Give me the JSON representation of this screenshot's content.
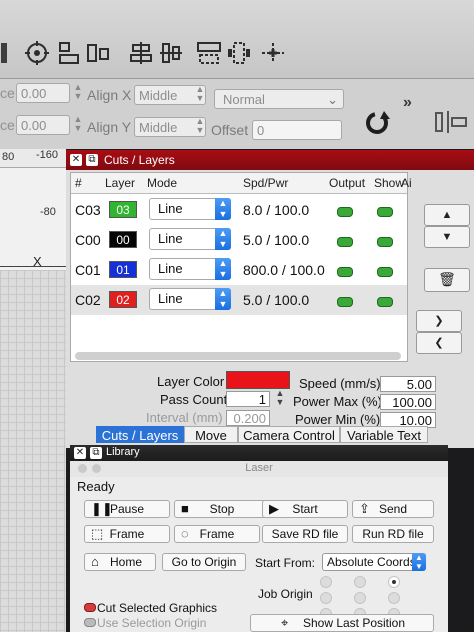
{
  "toolbar": {
    "icons": [
      "target-icon",
      "align-left-icon",
      "align-group-icon",
      "distribute-icon",
      "distribute-vertical-icon",
      "resize-icon",
      "shrink-icon",
      "anchor-icon"
    ]
  },
  "options": {
    "x_value": "0.00",
    "y_value": "0.00",
    "x_prefix": "ce",
    "y_prefix": "ce",
    "align_x_label": "Align X",
    "align_x_value": "Middle",
    "align_y_label": "Align Y",
    "align_y_value": "Middle",
    "normal_value": "Normal",
    "offset_label": "Offset",
    "offset_value": "0",
    "more_glyph": "»"
  },
  "ruler": {
    "top_left": "80",
    "top_right": "-160",
    "side_mark": "-80",
    "x_marker": "X"
  },
  "cuts": {
    "title": "Cuts / Layers",
    "headers": {
      "num": "#",
      "layer": "Layer",
      "mode": "Mode",
      "spd": "Spd/Pwr",
      "output": "Output",
      "show": "Show",
      "air": "Ai"
    },
    "rows": [
      {
        "name": "C03",
        "layer": "03",
        "color": "#2fb52f",
        "textcolor": "#ffffff",
        "mode": "Line",
        "spd": "8.0 / 100.0"
      },
      {
        "name": "C00",
        "layer": "00",
        "color": "#050505",
        "textcolor": "#ffffff",
        "mode": "Line",
        "spd": "5.0 / 100.0"
      },
      {
        "name": "C01",
        "layer": "01",
        "color": "#1430d6",
        "textcolor": "#ffffff",
        "mode": "Line",
        "spd": "800.0 / 100.0"
      },
      {
        "name": "C02",
        "layer": "02",
        "color": "#e01f1f",
        "textcolor": "#ffffff",
        "mode": "Line",
        "spd": "5.0 / 100.0"
      }
    ],
    "layer_color_label": "Layer Color",
    "layer_color": "#e8141a",
    "pass_count_label": "Pass Count",
    "pass_count": "1",
    "interval_label": "Interval (mm)",
    "interval": "0.200",
    "speed_label": "Speed (mm/s)",
    "speed": "5.00",
    "power_max_label": "Power Max (%)",
    "power_max": "100.00",
    "power_min_label": "Power Min (%)",
    "power_min": "10.00",
    "tabs": [
      "Cuts / Layers",
      "Move",
      "Camera Control",
      "Variable Text"
    ]
  },
  "library": {
    "title": "Library"
  },
  "laser": {
    "title": "Laser",
    "status": "Ready",
    "pause": "Pause",
    "stop": "Stop",
    "start": "Start",
    "send": "Send",
    "frame1": "Frame",
    "frame2": "Frame",
    "save_rd": "Save RD file",
    "run_rd": "Run RD file",
    "home": "Home",
    "go_origin": "Go to Origin",
    "start_from_label": "Start From:",
    "start_from_value": "Absolute Coords",
    "job_origin_label": "Job Origin",
    "cut_selected": "Cut Selected Graphics",
    "use_selection_origin": "Use Selection Origin",
    "show_last_position": "Show Last Position"
  },
  "colors": {
    "accent_red": "#9b0c12",
    "tab_active": "#2b72d6",
    "toggle_green": "#3aa93a"
  }
}
